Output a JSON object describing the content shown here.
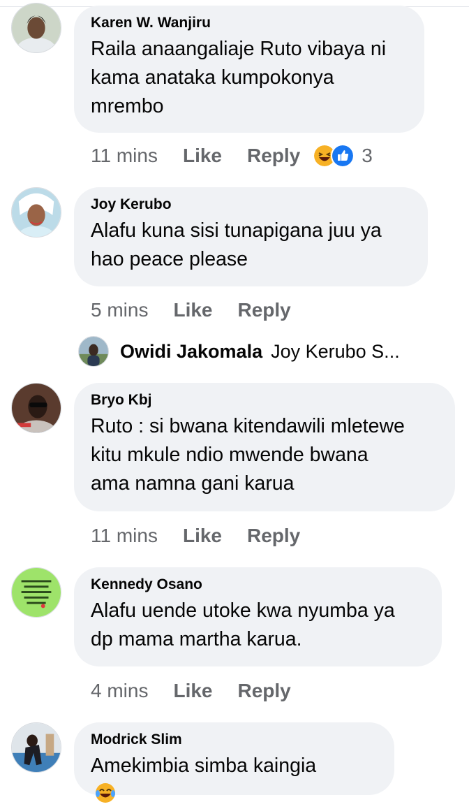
{
  "comments": [
    {
      "name": "Karen W. Wanjiru",
      "text": "Raila anaangaliaje Ruto vibaya ni\nkama anataka kumpokonya\nmrembo",
      "time": "11 mins",
      "like": "Like",
      "reply": "Reply",
      "reaction_count": "3",
      "reactions": [
        "haha-emoji",
        "like-thumb"
      ]
    },
    {
      "name": "Joy Kerubo",
      "text": "Alafu kuna sisi tunapigana juu ya\nhao peace please",
      "time": "5 mins",
      "like": "Like",
      "reply": "Reply"
    },
    {
      "name": "Bryo Kbj",
      "text": "Ruto : si bwana kitendawili mletewe\nkitu mkule ndio mwende bwana\nama namna gani karua",
      "time": "11 mins",
      "like": "Like",
      "reply": "Reply"
    },
    {
      "name": "Kennedy Osano",
      "text": "Alafu uende utoke kwa nyumba ya\ndp mama martha karua.",
      "time": "4 mins",
      "like": "Like",
      "reply": "Reply"
    },
    {
      "name": "Modrick Slim",
      "text": "Amekimbia simba kaingia",
      "trailing_emoji": "laughing-tears-emoji"
    }
  ],
  "reply_preview": {
    "name": "Owidi Jakomala",
    "snippet": "Joy Kerubo S..."
  },
  "colors": {
    "bubble": "#f0f2f5",
    "meta_text": "#65676b",
    "like_blue": "#1877f2",
    "haha_yellow": "#f7b125"
  }
}
